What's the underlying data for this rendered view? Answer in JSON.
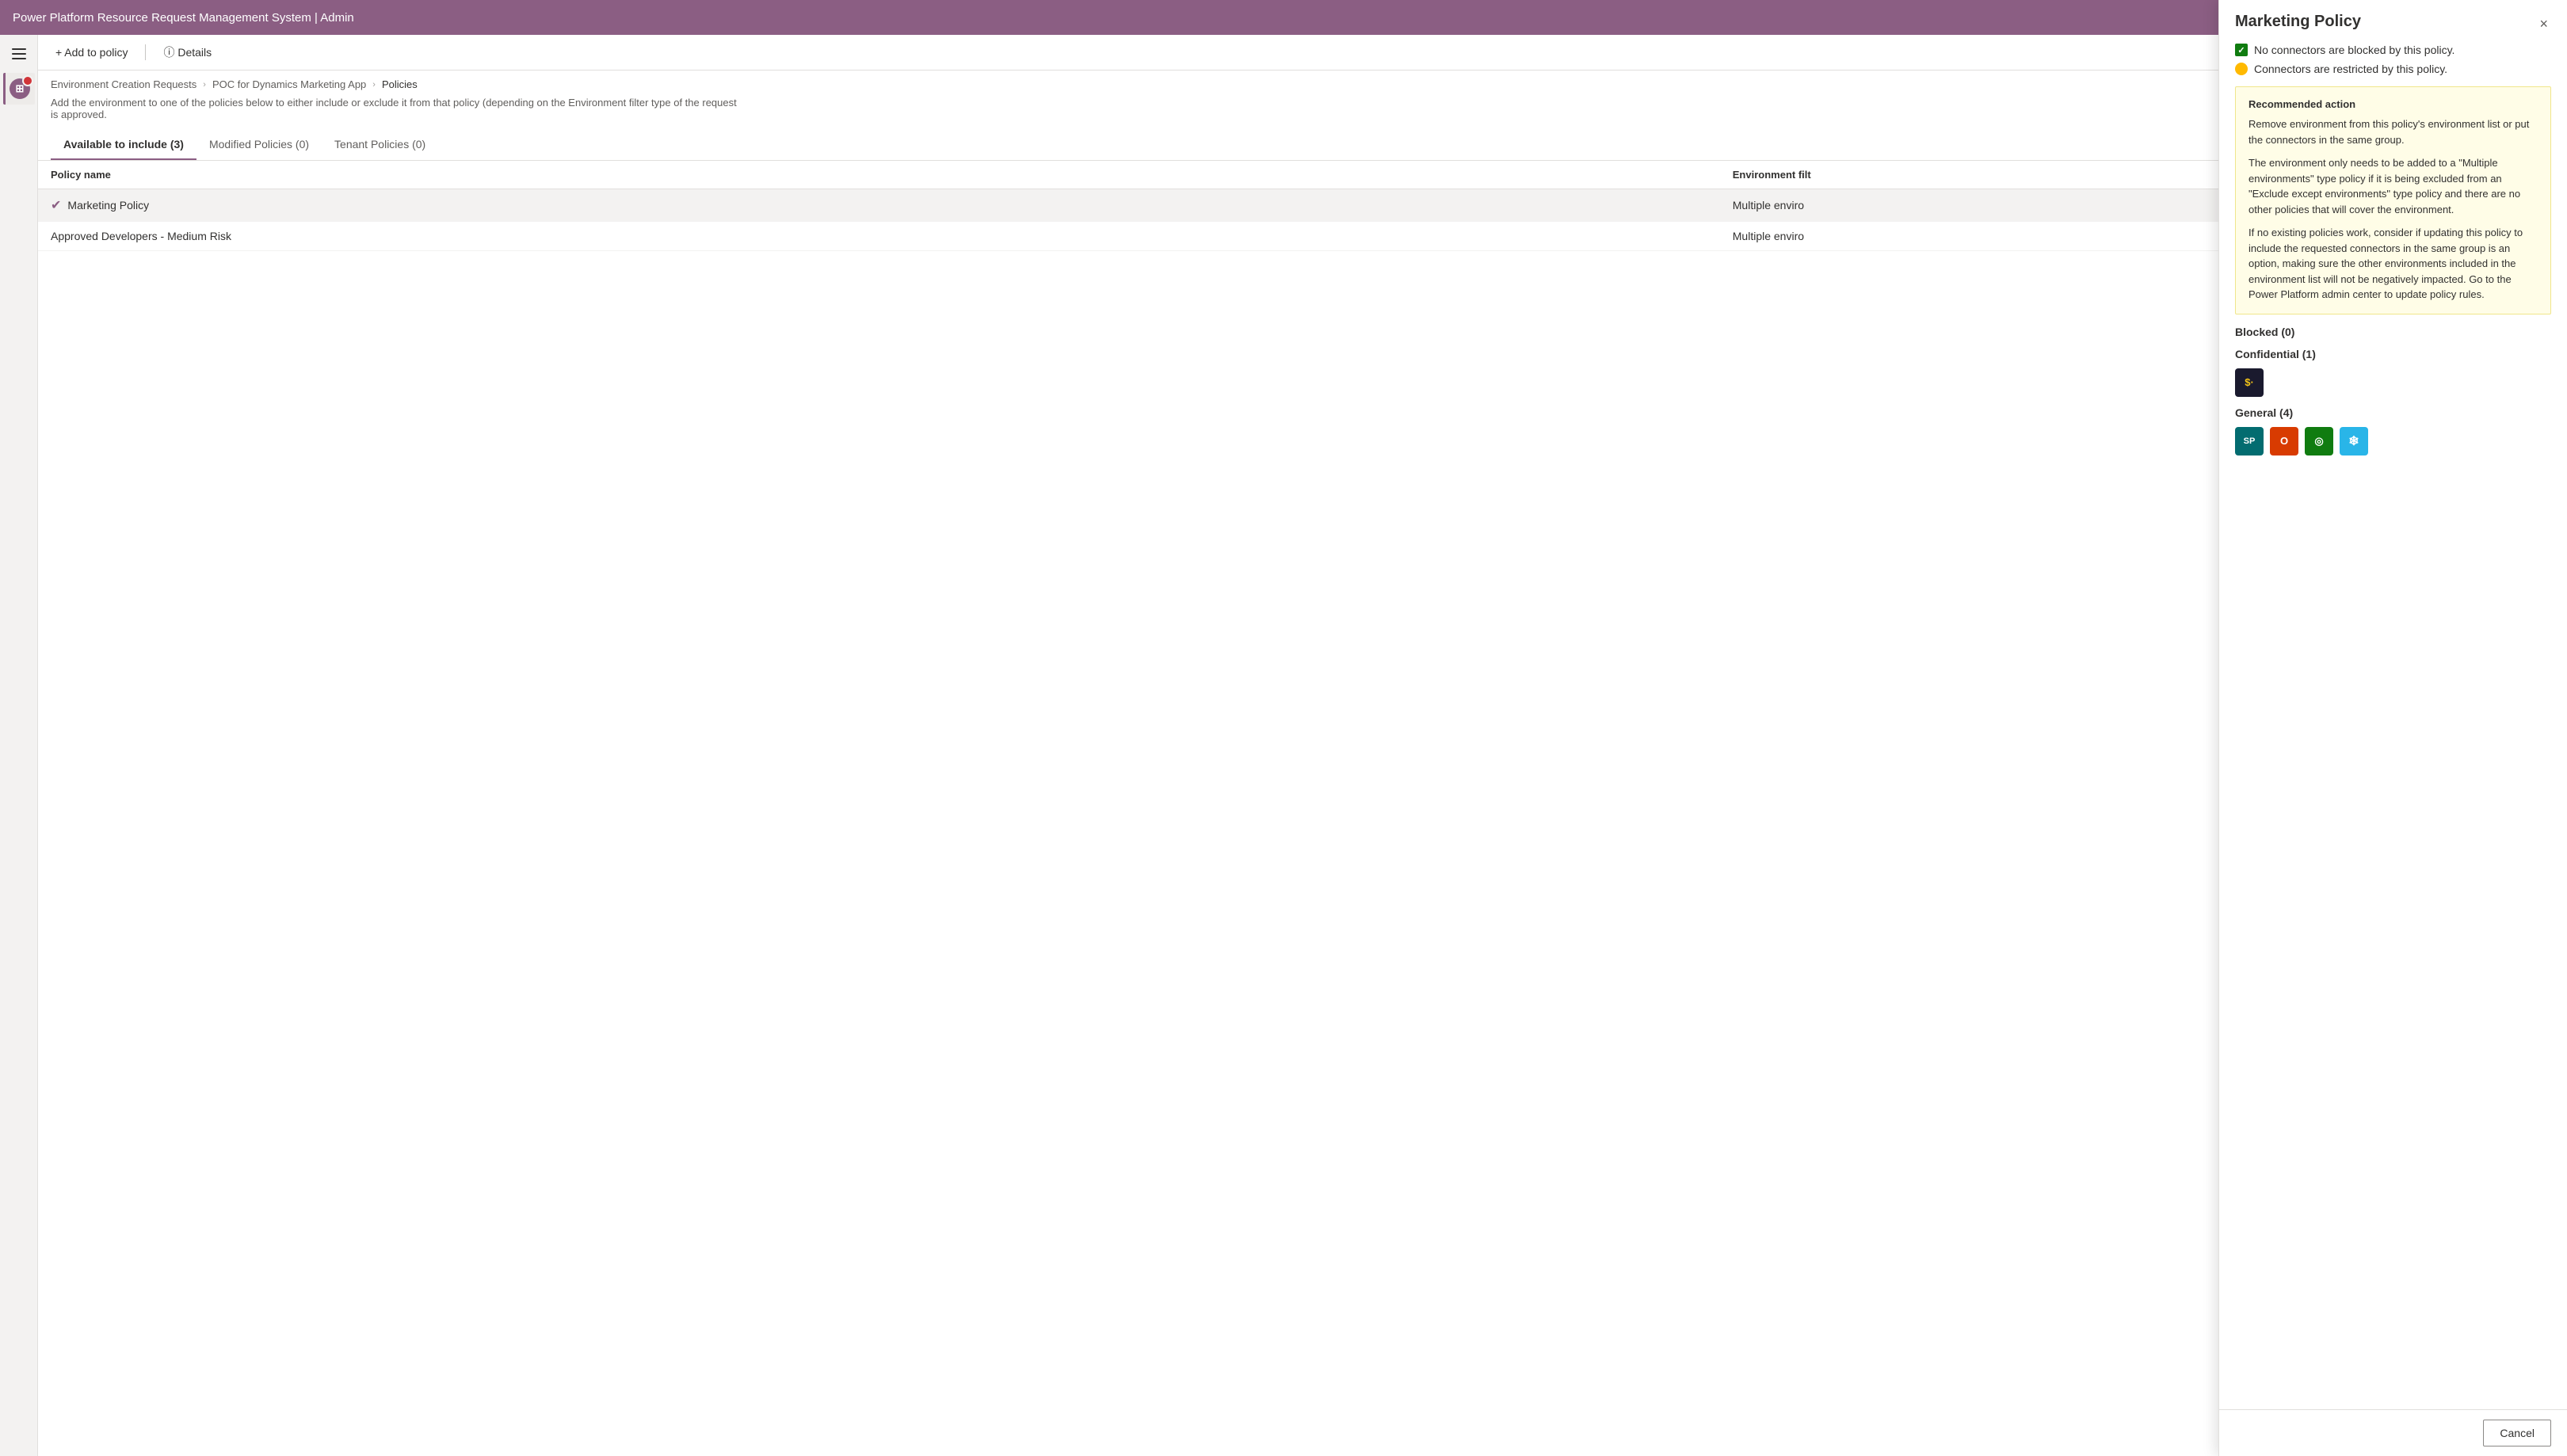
{
  "topbar": {
    "title": "Power Platform Resource Request Management System | Admin"
  },
  "toolbar": {
    "add_label": "+ Add to policy",
    "details_label": "ⓘ Details"
  },
  "breadcrumb": {
    "item1": "Environment Creation Requests",
    "item2": "POC for Dynamics Marketing App",
    "item3": "Policies"
  },
  "page_desc": "Add the environment to one of the policies below to either include or exclude it from that policy (depending on the Environment filter type of the request is approved.",
  "tabs": [
    {
      "label": "Available to include (3)",
      "active": true
    },
    {
      "label": "Modified Policies (0)",
      "active": false
    },
    {
      "label": "Tenant Policies (0)",
      "active": false
    }
  ],
  "table": {
    "columns": [
      "Policy name",
      "Environment filt"
    ],
    "rows": [
      {
        "name": "Marketing Policy",
        "env_filter": "Multiple enviro",
        "selected": true,
        "checked": true
      },
      {
        "name": "Approved Developers - Medium Risk",
        "env_filter": "Multiple enviro",
        "selected": false,
        "checked": false
      }
    ]
  },
  "panel": {
    "title": "Marketing Policy",
    "close_label": "×",
    "status_lines": [
      {
        "type": "green",
        "text": "No connectors are blocked by this policy."
      },
      {
        "type": "yellow",
        "text": "Connectors are restricted by this policy."
      }
    ],
    "recommended": {
      "label": "Recommended action",
      "paragraphs": [
        "Remove environment from this policy's environment list or put the connectors in the same group.",
        "The environment only needs to be added to a \"Multiple environments\" type policy if it is being excluded from an \"Exclude except environments\" type policy and there are no other policies that will cover the environment.",
        "If no existing policies work, consider if updating this policy to include the requested connectors in the same group is an option, making sure the other environments included in the environment list will not be negatively impacted. Go to the Power Platform admin center to update policy rules."
      ]
    },
    "blocked": {
      "label": "Blocked (0)",
      "icons": []
    },
    "confidential": {
      "label": "Confidential (1)",
      "icons": [
        {
          "type": "docusign",
          "label": "$"
        }
      ]
    },
    "general": {
      "label": "General (4)",
      "icons": [
        {
          "type": "sharepoint",
          "label": "SP"
        },
        {
          "type": "office",
          "label": "O"
        },
        {
          "type": "green",
          "label": "G"
        },
        {
          "type": "snowflake",
          "label": "❄"
        }
      ]
    },
    "cancel_label": "Cancel"
  }
}
